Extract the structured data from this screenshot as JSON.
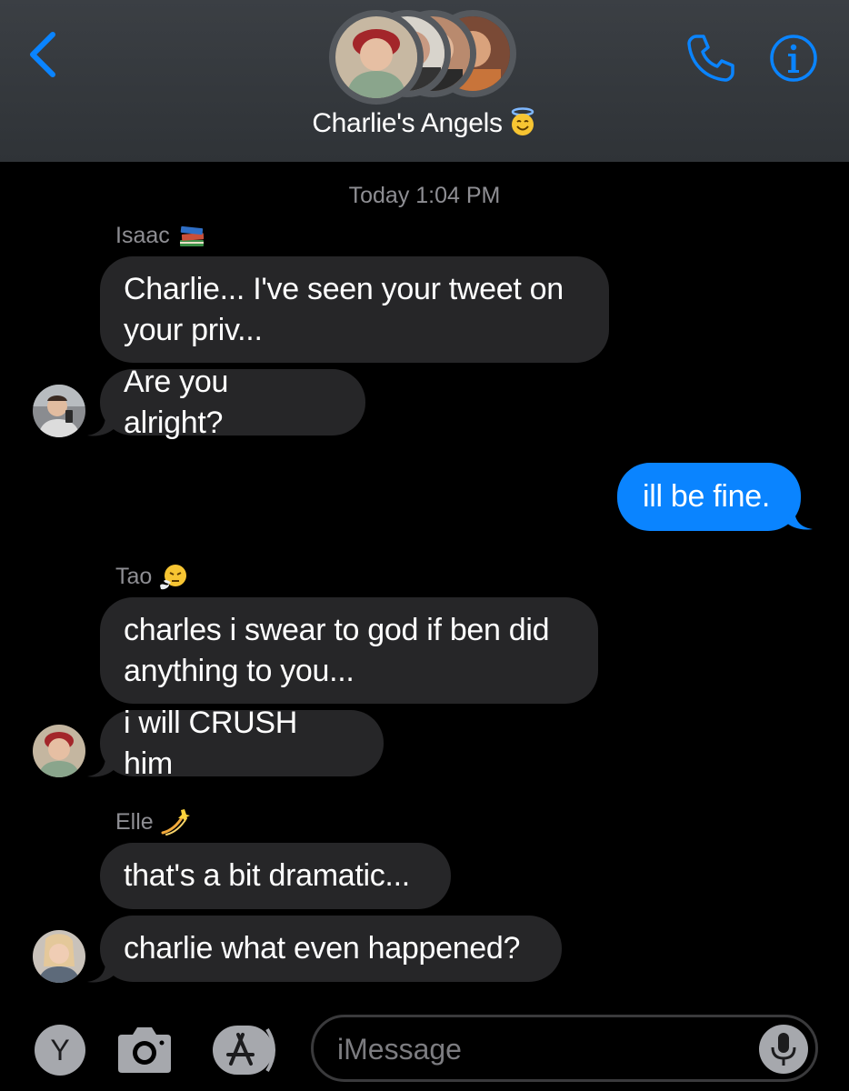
{
  "header": {
    "group_name": "Charlie's Angels",
    "name_emoji": "smiling-face-with-halo",
    "accent_color": "#0a84ff"
  },
  "conversation": {
    "timestamp": "Today 1:04 PM",
    "groups": [
      {
        "sender": "Isaac",
        "sender_emoji": "books",
        "messages": [
          "Charlie... I've seen your tweet on your priv...",
          "Are you alright?"
        ]
      },
      {
        "outgoing": true,
        "messages": [
          "ill be fine."
        ]
      },
      {
        "sender": "Tao",
        "sender_emoji": "face-with-steam",
        "messages": [
          "charles i swear to god if ben did anything to you...",
          "i will CRUSH him"
        ]
      },
      {
        "sender": "Elle",
        "sender_emoji": "dizzy",
        "messages": [
          "that's a bit dramatic...",
          "charlie what even happened?"
        ]
      }
    ]
  },
  "composer": {
    "avatar_initial": "Y",
    "placeholder": "iMessage"
  },
  "colors": {
    "incoming_bubble": "#262628",
    "outgoing_bubble": "#0a84ff",
    "header_bg": "#34383c",
    "muted_text": "#8e8e93"
  }
}
